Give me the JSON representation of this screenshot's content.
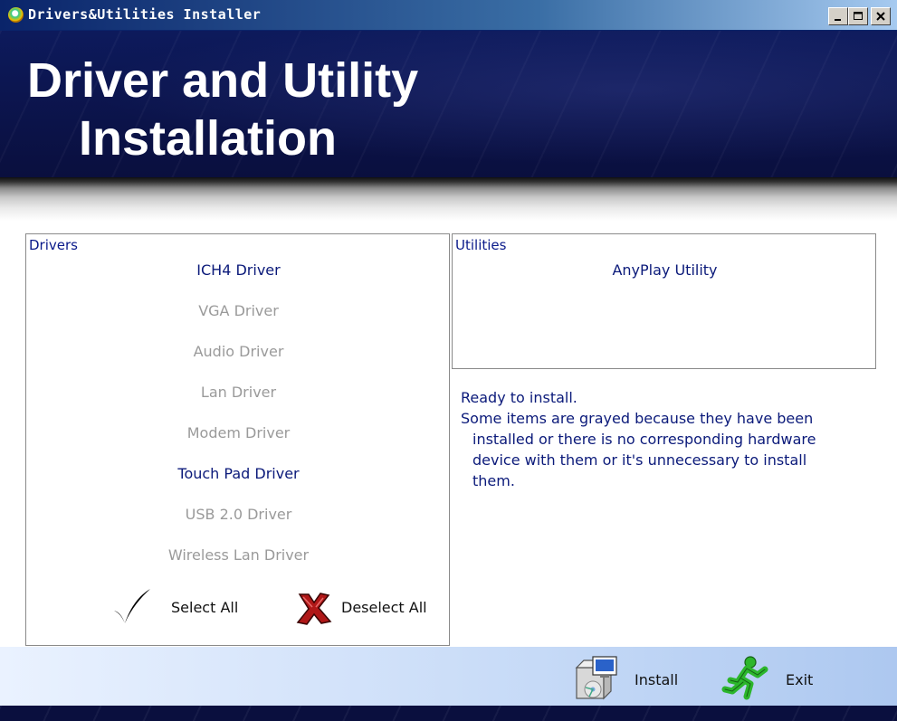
{
  "window": {
    "title": "Drivers&Utilities Installer",
    "controls": {
      "minimize_icon": "minimize-icon",
      "maximize_icon": "maximize-icon",
      "close_icon": "close-icon"
    }
  },
  "banner": {
    "line1": "Driver and Utility",
    "line2": "Installation"
  },
  "drivers": {
    "label": "Drivers",
    "items": [
      {
        "label": "ICH4 Driver",
        "enabled": true
      },
      {
        "label": "VGA Driver",
        "enabled": false
      },
      {
        "label": "Audio Driver",
        "enabled": false
      },
      {
        "label": "Lan Driver",
        "enabled": false
      },
      {
        "label": "Modem Driver",
        "enabled": false
      },
      {
        "label": "Touch Pad Driver",
        "enabled": true
      },
      {
        "label": "USB 2.0 Driver",
        "enabled": false
      },
      {
        "label": "Wireless Lan Driver",
        "enabled": false
      }
    ],
    "select_all": "Select All",
    "deselect_all": "Deselect All"
  },
  "utilities": {
    "label": "Utilities",
    "items": [
      {
        "label": "AnyPlay Utility",
        "enabled": true
      }
    ]
  },
  "status": {
    "line1": "Ready to install.",
    "line2": "Some items are grayed because they have been",
    "line3": "installed or there is no corresponding hardware",
    "line4": "device with them or it's unnecessary to install",
    "line5": "them."
  },
  "actions": {
    "install": "Install",
    "exit": "Exit"
  },
  "colors": {
    "enabled_text": "#0b1a7a",
    "disabled_text": "#9a9a9a",
    "banner_bg": "#0b1450"
  }
}
